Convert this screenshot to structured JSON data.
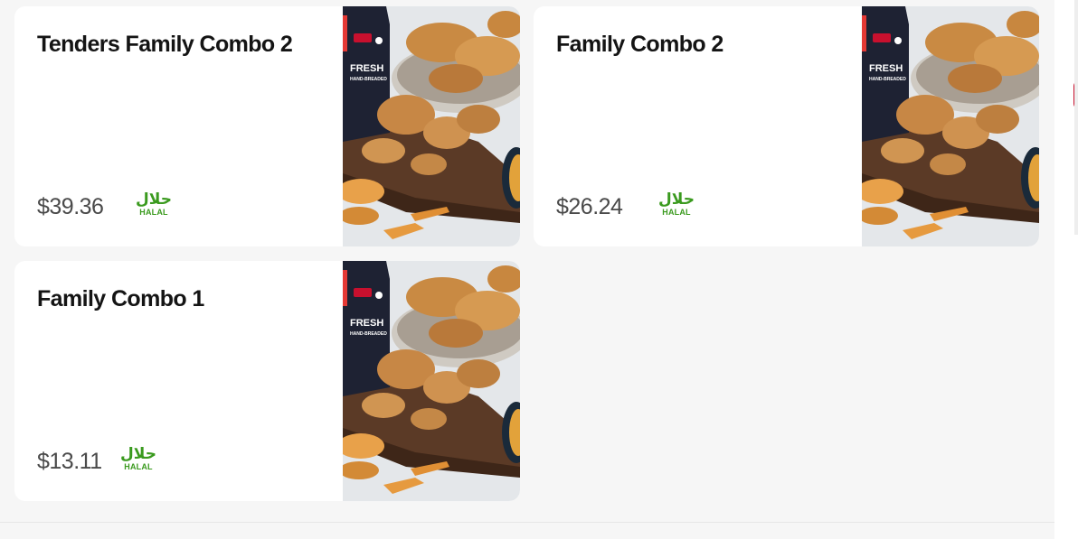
{
  "products": [
    {
      "name": "Tenders Family Combo 2",
      "price": "$39.36",
      "halal_arabic": "حلال",
      "halal_label": "HALAL"
    },
    {
      "name": "Family Combo 2",
      "price": "$26.24",
      "halal_arabic": "حلال",
      "halal_label": "HALAL"
    },
    {
      "name": "Family Combo 1",
      "price": "$13.11",
      "halal_arabic": "حلال",
      "halal_label": "HALAL"
    }
  ],
  "image": {
    "box_brand": "FRESH",
    "box_sub": "HAND-BREADED"
  },
  "colors": {
    "halal_green": "#3a9a1e",
    "card_bg": "#ffffff",
    "page_bg": "#f6f6f6"
  }
}
